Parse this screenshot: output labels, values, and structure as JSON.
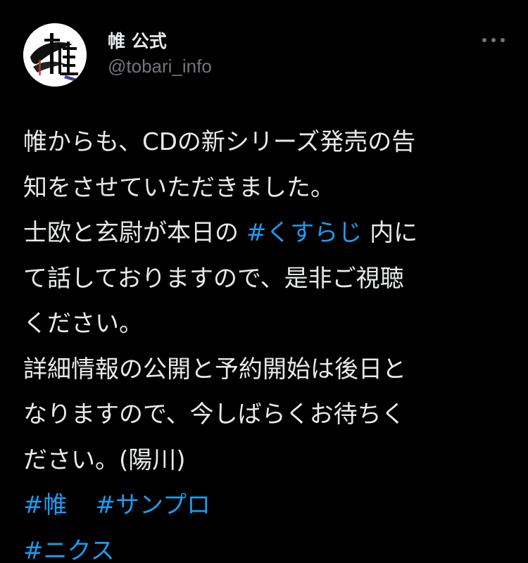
{
  "user": {
    "display_name": "帷 公式",
    "handle": "@tobari_info",
    "avatar_text": "帷"
  },
  "icons": {
    "more": "more-horizontal-icon"
  },
  "colors": {
    "background": "#000000",
    "text": "#E7E9EA",
    "secondary": "#71767B",
    "link": "#1D9BF0"
  },
  "tweet": {
    "lines": [
      {
        "text": "帷からも、CDの新シリーズ発売の告"
      },
      {
        "text": "知をさせていただきました。"
      },
      {
        "pre": "士欧と玄尉が本日の ",
        "hashtag": "#くすらじ",
        "post": " 内に"
      },
      {
        "text": "て話しておりますので、是非ご視聴"
      },
      {
        "text": "ください。"
      },
      {
        "text": "詳細情報の公開と予約開始は後日と"
      },
      {
        "text": "なりますので、今しばらくお待ちく"
      },
      {
        "text": "ださい。(陽川)"
      }
    ],
    "hashtags": [
      "#帷",
      "#サンプロ",
      "#ニクス"
    ]
  }
}
